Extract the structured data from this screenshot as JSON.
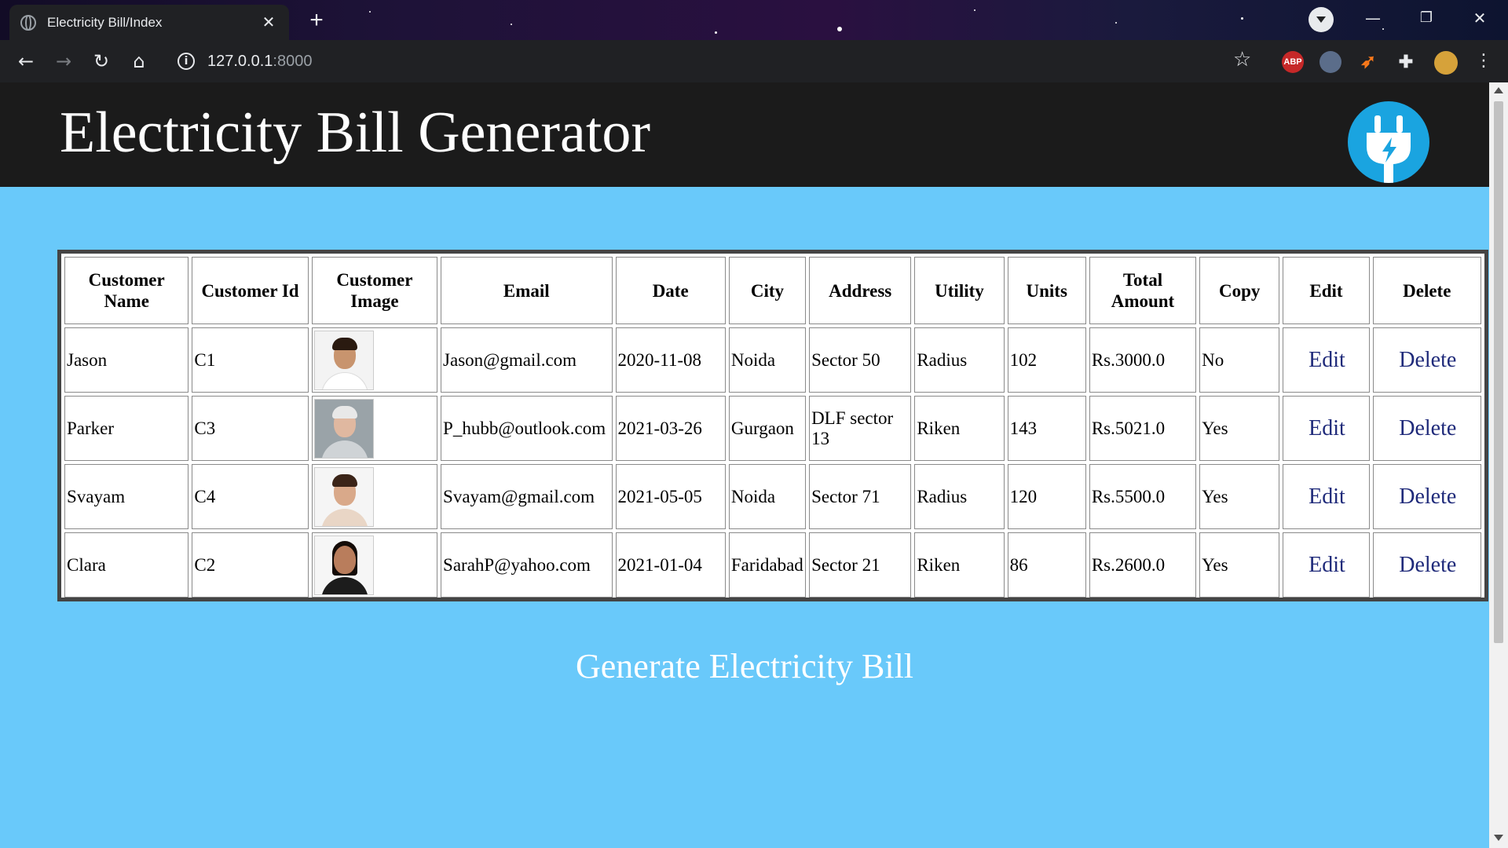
{
  "browser": {
    "tab_title": "Electricity Bill/Index",
    "url_host": "127.0.0.1",
    "url_port": ":8000",
    "ext_abp": "ABP"
  },
  "header": {
    "title": "Electricity Bill Generator"
  },
  "table": {
    "columns": [
      "Customer Name",
      "Customer Id",
      "Customer Image",
      "Email",
      "Date",
      "City",
      "Address",
      "Utility",
      "Units",
      "Total Amount",
      "Copy",
      "Edit",
      "Delete"
    ],
    "rows": [
      {
        "name": "Jason",
        "id": "C1",
        "email": "Jason@gmail.com",
        "date": "2020-11-08",
        "city": "Noida",
        "address": "Sector 50",
        "utility": "Radius",
        "units": "102",
        "total": "Rs.3000.0",
        "copy": "No",
        "edit": "Edit",
        "delete": "Delete"
      },
      {
        "name": "Parker",
        "id": "C3",
        "email": "P_hubb@outlook.com",
        "date": "2021-03-26",
        "city": "Gurgaon",
        "address": "DLF sector 13",
        "utility": "Riken",
        "units": "143",
        "total": "Rs.5021.0",
        "copy": "Yes",
        "edit": "Edit",
        "delete": "Delete"
      },
      {
        "name": "Svayam",
        "id": "C4",
        "email": "Svayam@gmail.com",
        "date": "2021-05-05",
        "city": "Noida",
        "address": "Sector 71",
        "utility": "Radius",
        "units": "120",
        "total": "Rs.5500.0",
        "copy": "Yes",
        "edit": "Edit",
        "delete": "Delete"
      },
      {
        "name": "Clara",
        "id": "C2",
        "email": "SarahP@yahoo.com",
        "date": "2021-01-04",
        "city": "Faridabad",
        "address": "Sector 21",
        "utility": "Riken",
        "units": "86",
        "total": "Rs.2600.0",
        "copy": "Yes",
        "edit": "Edit",
        "delete": "Delete"
      }
    ]
  },
  "generate_link": "Generate Electricity Bill",
  "colors": {
    "page_bg": "#69c9fa",
    "header_bg": "#1b1b1b",
    "link": "#1f2a7a",
    "logo": "#1aa4e0"
  }
}
